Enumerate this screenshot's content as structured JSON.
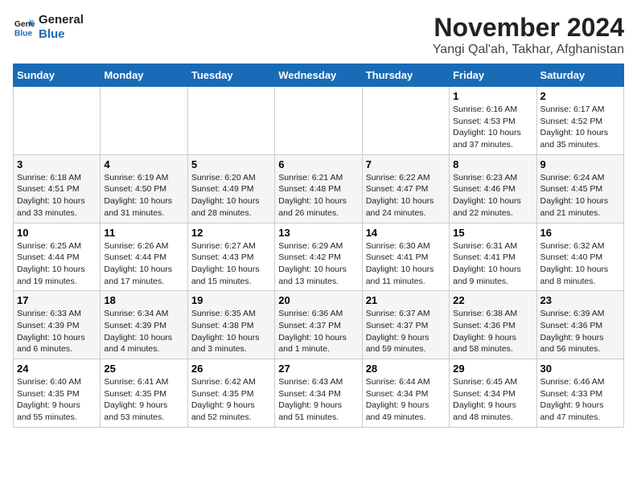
{
  "header": {
    "logo_line1": "General",
    "logo_line2": "Blue",
    "month": "November 2024",
    "location": "Yangi Qal'ah, Takhar, Afghanistan"
  },
  "weekdays": [
    "Sunday",
    "Monday",
    "Tuesday",
    "Wednesday",
    "Thursday",
    "Friday",
    "Saturday"
  ],
  "weeks": [
    [
      {
        "day": "",
        "info": ""
      },
      {
        "day": "",
        "info": ""
      },
      {
        "day": "",
        "info": ""
      },
      {
        "day": "",
        "info": ""
      },
      {
        "day": "",
        "info": ""
      },
      {
        "day": "1",
        "info": "Sunrise: 6:16 AM\nSunset: 4:53 PM\nDaylight: 10 hours\nand 37 minutes."
      },
      {
        "day": "2",
        "info": "Sunrise: 6:17 AM\nSunset: 4:52 PM\nDaylight: 10 hours\nand 35 minutes."
      }
    ],
    [
      {
        "day": "3",
        "info": "Sunrise: 6:18 AM\nSunset: 4:51 PM\nDaylight: 10 hours\nand 33 minutes."
      },
      {
        "day": "4",
        "info": "Sunrise: 6:19 AM\nSunset: 4:50 PM\nDaylight: 10 hours\nand 31 minutes."
      },
      {
        "day": "5",
        "info": "Sunrise: 6:20 AM\nSunset: 4:49 PM\nDaylight: 10 hours\nand 28 minutes."
      },
      {
        "day": "6",
        "info": "Sunrise: 6:21 AM\nSunset: 4:48 PM\nDaylight: 10 hours\nand 26 minutes."
      },
      {
        "day": "7",
        "info": "Sunrise: 6:22 AM\nSunset: 4:47 PM\nDaylight: 10 hours\nand 24 minutes."
      },
      {
        "day": "8",
        "info": "Sunrise: 6:23 AM\nSunset: 4:46 PM\nDaylight: 10 hours\nand 22 minutes."
      },
      {
        "day": "9",
        "info": "Sunrise: 6:24 AM\nSunset: 4:45 PM\nDaylight: 10 hours\nand 21 minutes."
      }
    ],
    [
      {
        "day": "10",
        "info": "Sunrise: 6:25 AM\nSunset: 4:44 PM\nDaylight: 10 hours\nand 19 minutes."
      },
      {
        "day": "11",
        "info": "Sunrise: 6:26 AM\nSunset: 4:44 PM\nDaylight: 10 hours\nand 17 minutes."
      },
      {
        "day": "12",
        "info": "Sunrise: 6:27 AM\nSunset: 4:43 PM\nDaylight: 10 hours\nand 15 minutes."
      },
      {
        "day": "13",
        "info": "Sunrise: 6:29 AM\nSunset: 4:42 PM\nDaylight: 10 hours\nand 13 minutes."
      },
      {
        "day": "14",
        "info": "Sunrise: 6:30 AM\nSunset: 4:41 PM\nDaylight: 10 hours\nand 11 minutes."
      },
      {
        "day": "15",
        "info": "Sunrise: 6:31 AM\nSunset: 4:41 PM\nDaylight: 10 hours\nand 9 minutes."
      },
      {
        "day": "16",
        "info": "Sunrise: 6:32 AM\nSunset: 4:40 PM\nDaylight: 10 hours\nand 8 minutes."
      }
    ],
    [
      {
        "day": "17",
        "info": "Sunrise: 6:33 AM\nSunset: 4:39 PM\nDaylight: 10 hours\nand 6 minutes."
      },
      {
        "day": "18",
        "info": "Sunrise: 6:34 AM\nSunset: 4:39 PM\nDaylight: 10 hours\nand 4 minutes."
      },
      {
        "day": "19",
        "info": "Sunrise: 6:35 AM\nSunset: 4:38 PM\nDaylight: 10 hours\nand 3 minutes."
      },
      {
        "day": "20",
        "info": "Sunrise: 6:36 AM\nSunset: 4:37 PM\nDaylight: 10 hours\nand 1 minute."
      },
      {
        "day": "21",
        "info": "Sunrise: 6:37 AM\nSunset: 4:37 PM\nDaylight: 9 hours\nand 59 minutes."
      },
      {
        "day": "22",
        "info": "Sunrise: 6:38 AM\nSunset: 4:36 PM\nDaylight: 9 hours\nand 58 minutes."
      },
      {
        "day": "23",
        "info": "Sunrise: 6:39 AM\nSunset: 4:36 PM\nDaylight: 9 hours\nand 56 minutes."
      }
    ],
    [
      {
        "day": "24",
        "info": "Sunrise: 6:40 AM\nSunset: 4:35 PM\nDaylight: 9 hours\nand 55 minutes."
      },
      {
        "day": "25",
        "info": "Sunrise: 6:41 AM\nSunset: 4:35 PM\nDaylight: 9 hours\nand 53 minutes."
      },
      {
        "day": "26",
        "info": "Sunrise: 6:42 AM\nSunset: 4:35 PM\nDaylight: 9 hours\nand 52 minutes."
      },
      {
        "day": "27",
        "info": "Sunrise: 6:43 AM\nSunset: 4:34 PM\nDaylight: 9 hours\nand 51 minutes."
      },
      {
        "day": "28",
        "info": "Sunrise: 6:44 AM\nSunset: 4:34 PM\nDaylight: 9 hours\nand 49 minutes."
      },
      {
        "day": "29",
        "info": "Sunrise: 6:45 AM\nSunset: 4:34 PM\nDaylight: 9 hours\nand 48 minutes."
      },
      {
        "day": "30",
        "info": "Sunrise: 6:46 AM\nSunset: 4:33 PM\nDaylight: 9 hours\nand 47 minutes."
      }
    ]
  ]
}
